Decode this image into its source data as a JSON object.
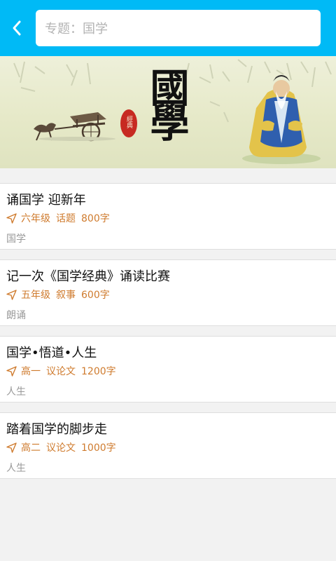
{
  "header": {
    "back_icon": "chevron-left-icon",
    "search_value": "专题：国学"
  },
  "banner": {
    "calligraphy": "國學",
    "seal": "經典"
  },
  "articles": [
    {
      "title": "诵国学 迎新年",
      "grade": "六年级",
      "type": "话题",
      "words": "800字",
      "tag": "国学"
    },
    {
      "title": "记一次《国学经典》诵读比赛",
      "grade": "五年级",
      "type": "叙事",
      "words": "600字",
      "tag": "朗诵"
    },
    {
      "title": "国学•悟道•人生",
      "grade": "高一",
      "type": "议论文",
      "words": "1200字",
      "tag": "人生"
    },
    {
      "title": "踏着国学的脚步走",
      "grade": "高二",
      "type": "议论文",
      "words": "1000字",
      "tag": "人生"
    }
  ],
  "colors": {
    "accent": "#00baf6",
    "meta": "#cf7b2e",
    "tag": "#999999"
  }
}
